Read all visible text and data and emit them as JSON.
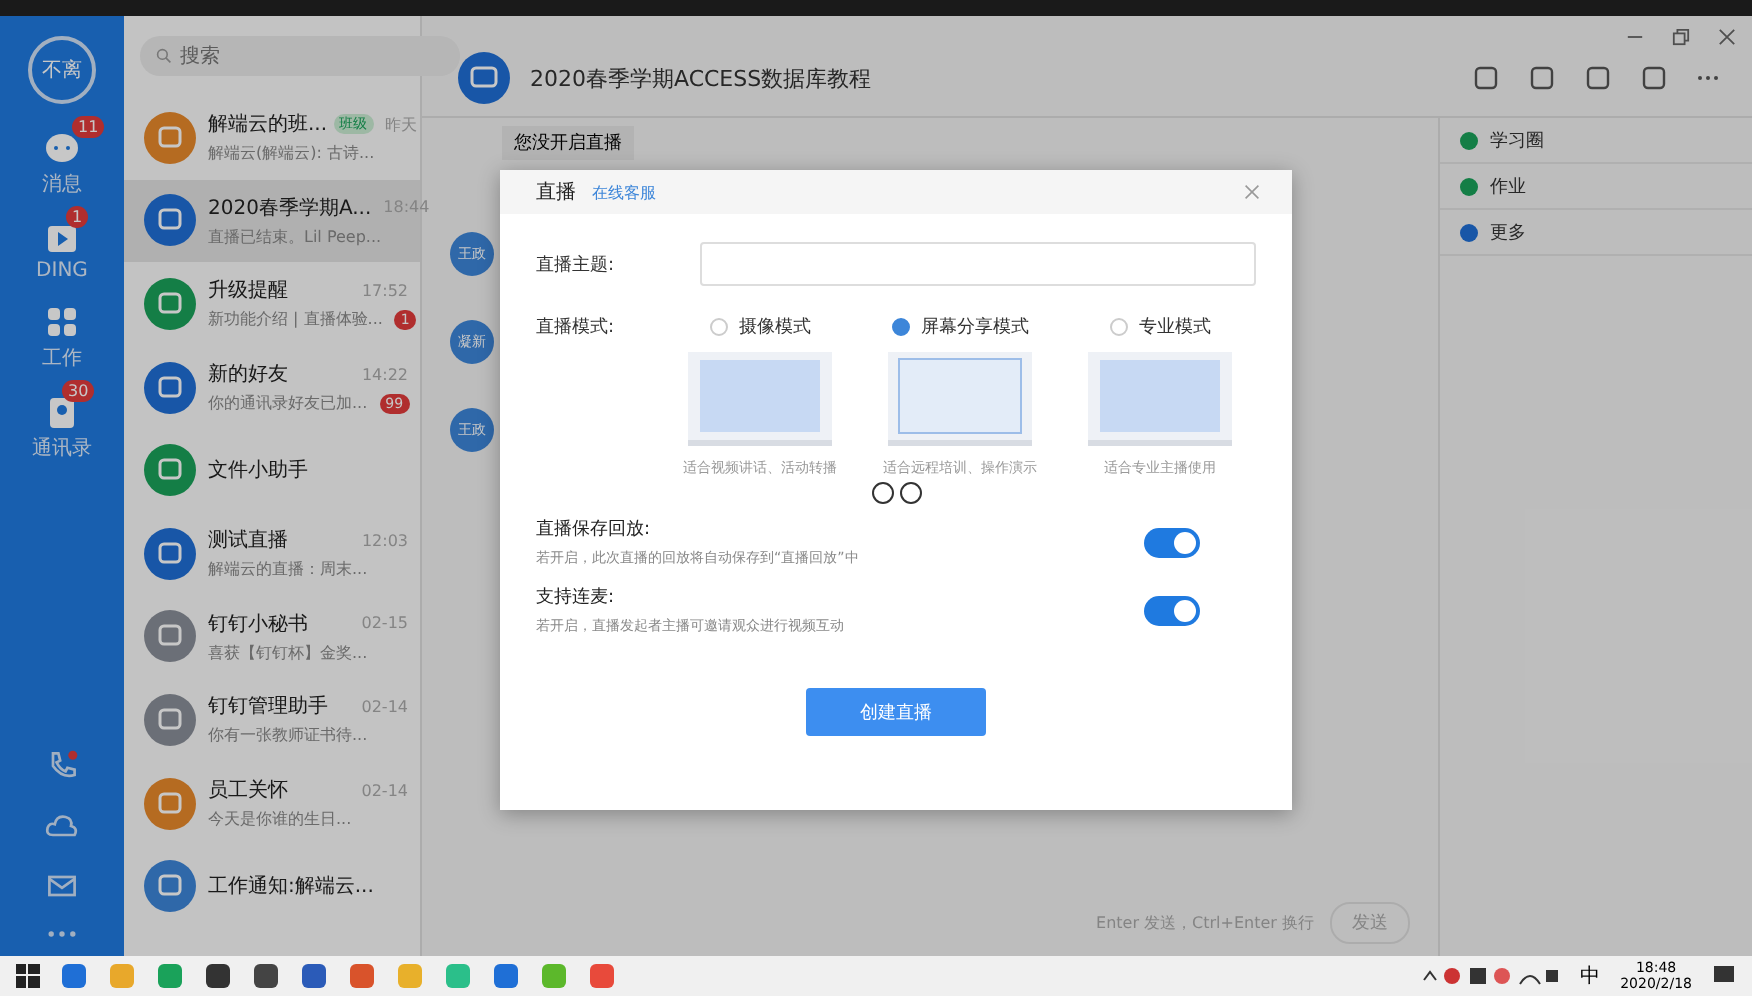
{
  "profile": {
    "label": "不离"
  },
  "nav": [
    {
      "label": "消息",
      "badge": "11"
    },
    {
      "label": "DING",
      "badge": "1"
    },
    {
      "label": "工作"
    },
    {
      "label": "通讯录",
      "badge": "30"
    }
  ],
  "search": {
    "placeholder": "搜索"
  },
  "conversations": [
    {
      "name": "解端云的班...",
      "tag": "班级",
      "time": "昨天",
      "preview": "解端云(解端云): 古诗...",
      "selected": false
    },
    {
      "name": "2020春季学期A...",
      "time": "18:44",
      "preview": "直播已结束。Lil Peep...",
      "selected": true
    },
    {
      "name": "升级提醒",
      "time": "17:52",
      "preview": "新功能介绍 | 直播体验...",
      "badge": "1",
      "selected": false
    },
    {
      "name": "新的好友",
      "time": "14:22",
      "preview": "你的通讯录好友已加...",
      "badge": "99",
      "selected": false
    },
    {
      "name": "文件小助手",
      "selected": false
    },
    {
      "name": "测试直播",
      "time": "12:03",
      "preview": "解端云的直播：周末...",
      "selected": false
    },
    {
      "name": "钉钉小秘书",
      "time": "02-15",
      "preview": "喜获【钉钉杯】金奖...",
      "selected": false
    },
    {
      "name": "钉钉管理助手",
      "time": "02-14",
      "preview": "你有一张教师证书待...",
      "selected": false
    },
    {
      "name": "员工关怀",
      "time": "02-14",
      "preview": "今天是你谁的生日...",
      "selected": false
    },
    {
      "name": "工作通知:解端云...",
      "selected": false
    }
  ],
  "chat": {
    "title": "2020春季学期ACCESS数据库教程",
    "notice": "您没开启直播",
    "avatars": [
      "王政",
      "凝新",
      "王政"
    ],
    "hint": "Enter 发送，Ctrl+Enter 换行",
    "send": "发送"
  },
  "side_panel": [
    {
      "label": "学习圈"
    },
    {
      "label": "作业"
    },
    {
      "label": "更多"
    }
  ],
  "dialog": {
    "title": "直播",
    "link": "在线客服",
    "topic_label": "直播主题:",
    "mode_label": "直播模式:",
    "modes": [
      {
        "label": "摄像模式",
        "desc": "适合视频讲话、活动转播",
        "selected": false
      },
      {
        "label": "屏幕分享模式",
        "desc": "适合远程培训、操作演示",
        "selected": true
      },
      {
        "label": "专业模式",
        "desc": "适合专业主播使用",
        "selected": false
      }
    ],
    "options": [
      {
        "title": "直播保存回放:",
        "desc": "若开启，此次直播的回放将自动保存到“直播回放”中",
        "on": true
      },
      {
        "title": "支持连麦:",
        "desc": "若开启，直播发起者主播可邀请观众进行视频互动",
        "on": true
      }
    ],
    "create": "创建直播"
  },
  "taskbar": {
    "ime": "中",
    "time": "18:48",
    "date": "2020/2/18"
  }
}
